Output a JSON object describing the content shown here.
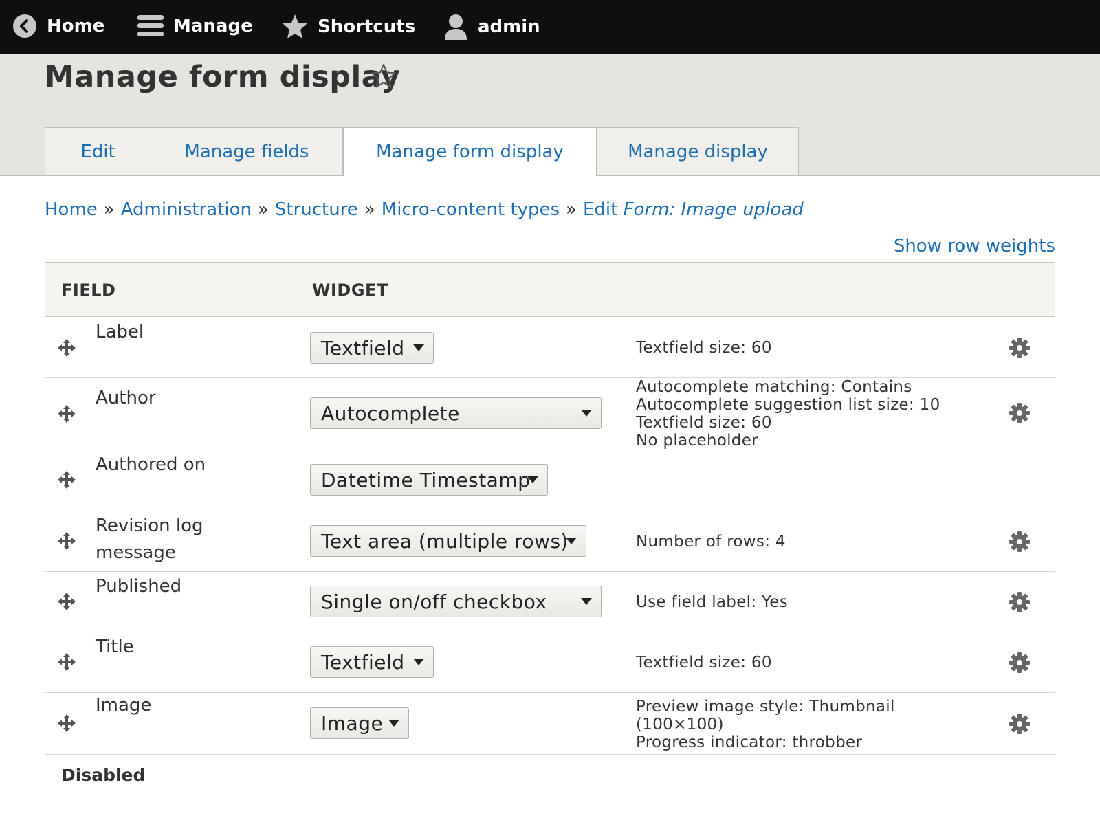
{
  "toolbar": {
    "home": "Home",
    "manage": "Manage",
    "shortcuts": "Shortcuts",
    "user": "admin"
  },
  "page": {
    "title": "Manage form display"
  },
  "tabs": [
    {
      "label": "Edit",
      "active": false
    },
    {
      "label": "Manage fields",
      "active": false
    },
    {
      "label": "Manage form display",
      "active": true
    },
    {
      "label": "Manage display",
      "active": false
    }
  ],
  "breadcrumb": {
    "items": [
      "Home",
      "Administration",
      "Structure",
      "Micro-content types",
      "Edit"
    ],
    "separator": "»",
    "current": "Form: Image upload"
  },
  "show_row_weights": "Show row weights",
  "table": {
    "headers": {
      "field": "FIELD",
      "widget": "WIDGET"
    },
    "rows": [
      {
        "field": "Label",
        "widget": "Textfield",
        "summary": [
          "Textfield size: 60"
        ]
      },
      {
        "field": "Author",
        "widget": "Autocomplete",
        "summary": [
          "Autocomplete matching: Contains",
          "Autocomplete suggestion list size: 10",
          "Textfield size: 60",
          "No placeholder"
        ]
      },
      {
        "field": "Authored on",
        "widget": "Datetime Timestamp",
        "summary": []
      },
      {
        "field": "Revision log message",
        "widget": "Text area (multiple rows)",
        "summary": [
          "Number of rows: 4"
        ]
      },
      {
        "field": "Published",
        "widget": "Single on/off checkbox",
        "summary": [
          "Use field label: Yes"
        ]
      },
      {
        "field": "Title",
        "widget": "Textfield",
        "summary": [
          "Textfield size: 60"
        ]
      },
      {
        "field": "Image",
        "widget": "Image",
        "summary": [
          "Preview image style: Thumbnail",
          "(100×100)",
          "Progress indicator: throbber"
        ]
      }
    ]
  },
  "disabled_section": "Disabled",
  "colors": {
    "toolbar_bg": "#0f0f0f",
    "header_bg": "#e5e4df",
    "link": "#1f6db3",
    "text": "#333333"
  }
}
